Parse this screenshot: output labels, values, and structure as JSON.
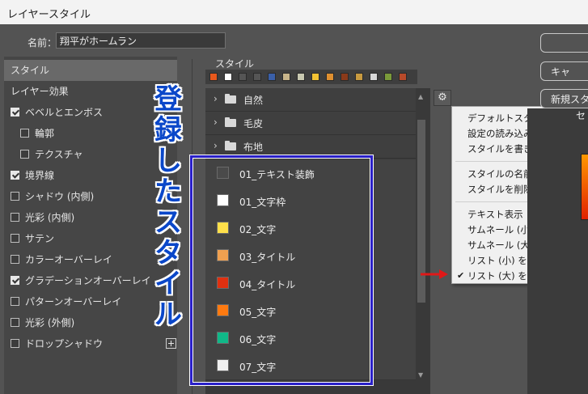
{
  "window": {
    "title": "レイヤースタイル"
  },
  "name_field": {
    "label": "名前：",
    "value": "翔平がホームラン"
  },
  "left_panel": {
    "items": [
      {
        "label": "スタイル",
        "checkbox": false,
        "checked": false,
        "selected": true
      },
      {
        "label": "レイヤー効果",
        "checkbox": false,
        "checked": false,
        "selected": false
      },
      {
        "label": "ベベルとエンボス",
        "checkbox": true,
        "checked": true,
        "selected": false
      },
      {
        "label": "輪郭",
        "checkbox": true,
        "checked": false,
        "selected": false,
        "indent": true
      },
      {
        "label": "テクスチャ",
        "checkbox": true,
        "checked": false,
        "selected": false,
        "indent": true
      },
      {
        "label": "境界線",
        "checkbox": true,
        "checked": true,
        "selected": false
      },
      {
        "label": "シャドウ (内側)",
        "checkbox": true,
        "checked": false,
        "selected": false
      },
      {
        "label": "光彩 (内側)",
        "checkbox": true,
        "checked": false,
        "selected": false
      },
      {
        "label": "サテン",
        "checkbox": true,
        "checked": false,
        "selected": false
      },
      {
        "label": "カラーオーバーレイ",
        "checkbox": true,
        "checked": false,
        "selected": false
      },
      {
        "label": "グラデーションオーバーレイ",
        "checkbox": true,
        "checked": true,
        "selected": false
      },
      {
        "label": "パターンオーバーレイ",
        "checkbox": true,
        "checked": false,
        "selected": false
      },
      {
        "label": "光彩 (外側)",
        "checkbox": true,
        "checked": false,
        "selected": false
      },
      {
        "label": "ドロップシャドウ",
        "checkbox": true,
        "checked": false,
        "selected": false
      }
    ]
  },
  "styles_panel": {
    "title": "スタイル",
    "recent_swatches": [
      "#e8581c",
      "#ffffff",
      "#555555",
      "#555555",
      "#3a5fa8",
      "#c8b58a",
      "#c8c8b0",
      "#f2c233",
      "#e09030",
      "#8a3a1a",
      "#c89a40",
      "#d8d8d8",
      "#7a9a3a",
      "#b84a2a"
    ],
    "folders": [
      "自然",
      "毛皮",
      "布地"
    ],
    "styles": [
      {
        "label": "01_テキスト装飾",
        "color": "#4a4a4a"
      },
      {
        "label": "01_文字枠",
        "color": "#ffffff"
      },
      {
        "label": "02_文字",
        "color": "#ffe04a"
      },
      {
        "label": "03_タイトル",
        "color": "#f0a050"
      },
      {
        "label": "04_タイトル",
        "color": "#e03010"
      },
      {
        "label": "05_文字",
        "color": "#ff7a10"
      },
      {
        "label": "06_文字",
        "color": "#10b888"
      },
      {
        "label": "07_文字",
        "color": "#f0f0f0"
      }
    ]
  },
  "annotation": {
    "chars": [
      "登",
      "録",
      "し",
      "た",
      "ス",
      "タ",
      "イ",
      "ル"
    ],
    "color": "#0a47c9",
    "box_color": "#2a20c8"
  },
  "context_menu": {
    "group1": [
      "デフォルトスタイルを追加...",
      "設定の読み込み...",
      "スタイルを書き出し..."
    ],
    "group2": [
      "スタイルの名前を変更...",
      "スタイルを削除..."
    ],
    "group3": [
      "テキスト表示",
      "サムネール (小) を表示",
      "サムネール (大) を表示",
      "リスト (小) を表示",
      "リスト (大) を表示"
    ],
    "checked_item": "リスト (大) を表示"
  },
  "right_buttons": [
    "",
    "キャ",
    "新規スタ"
  ],
  "preview_label": "セ"
}
